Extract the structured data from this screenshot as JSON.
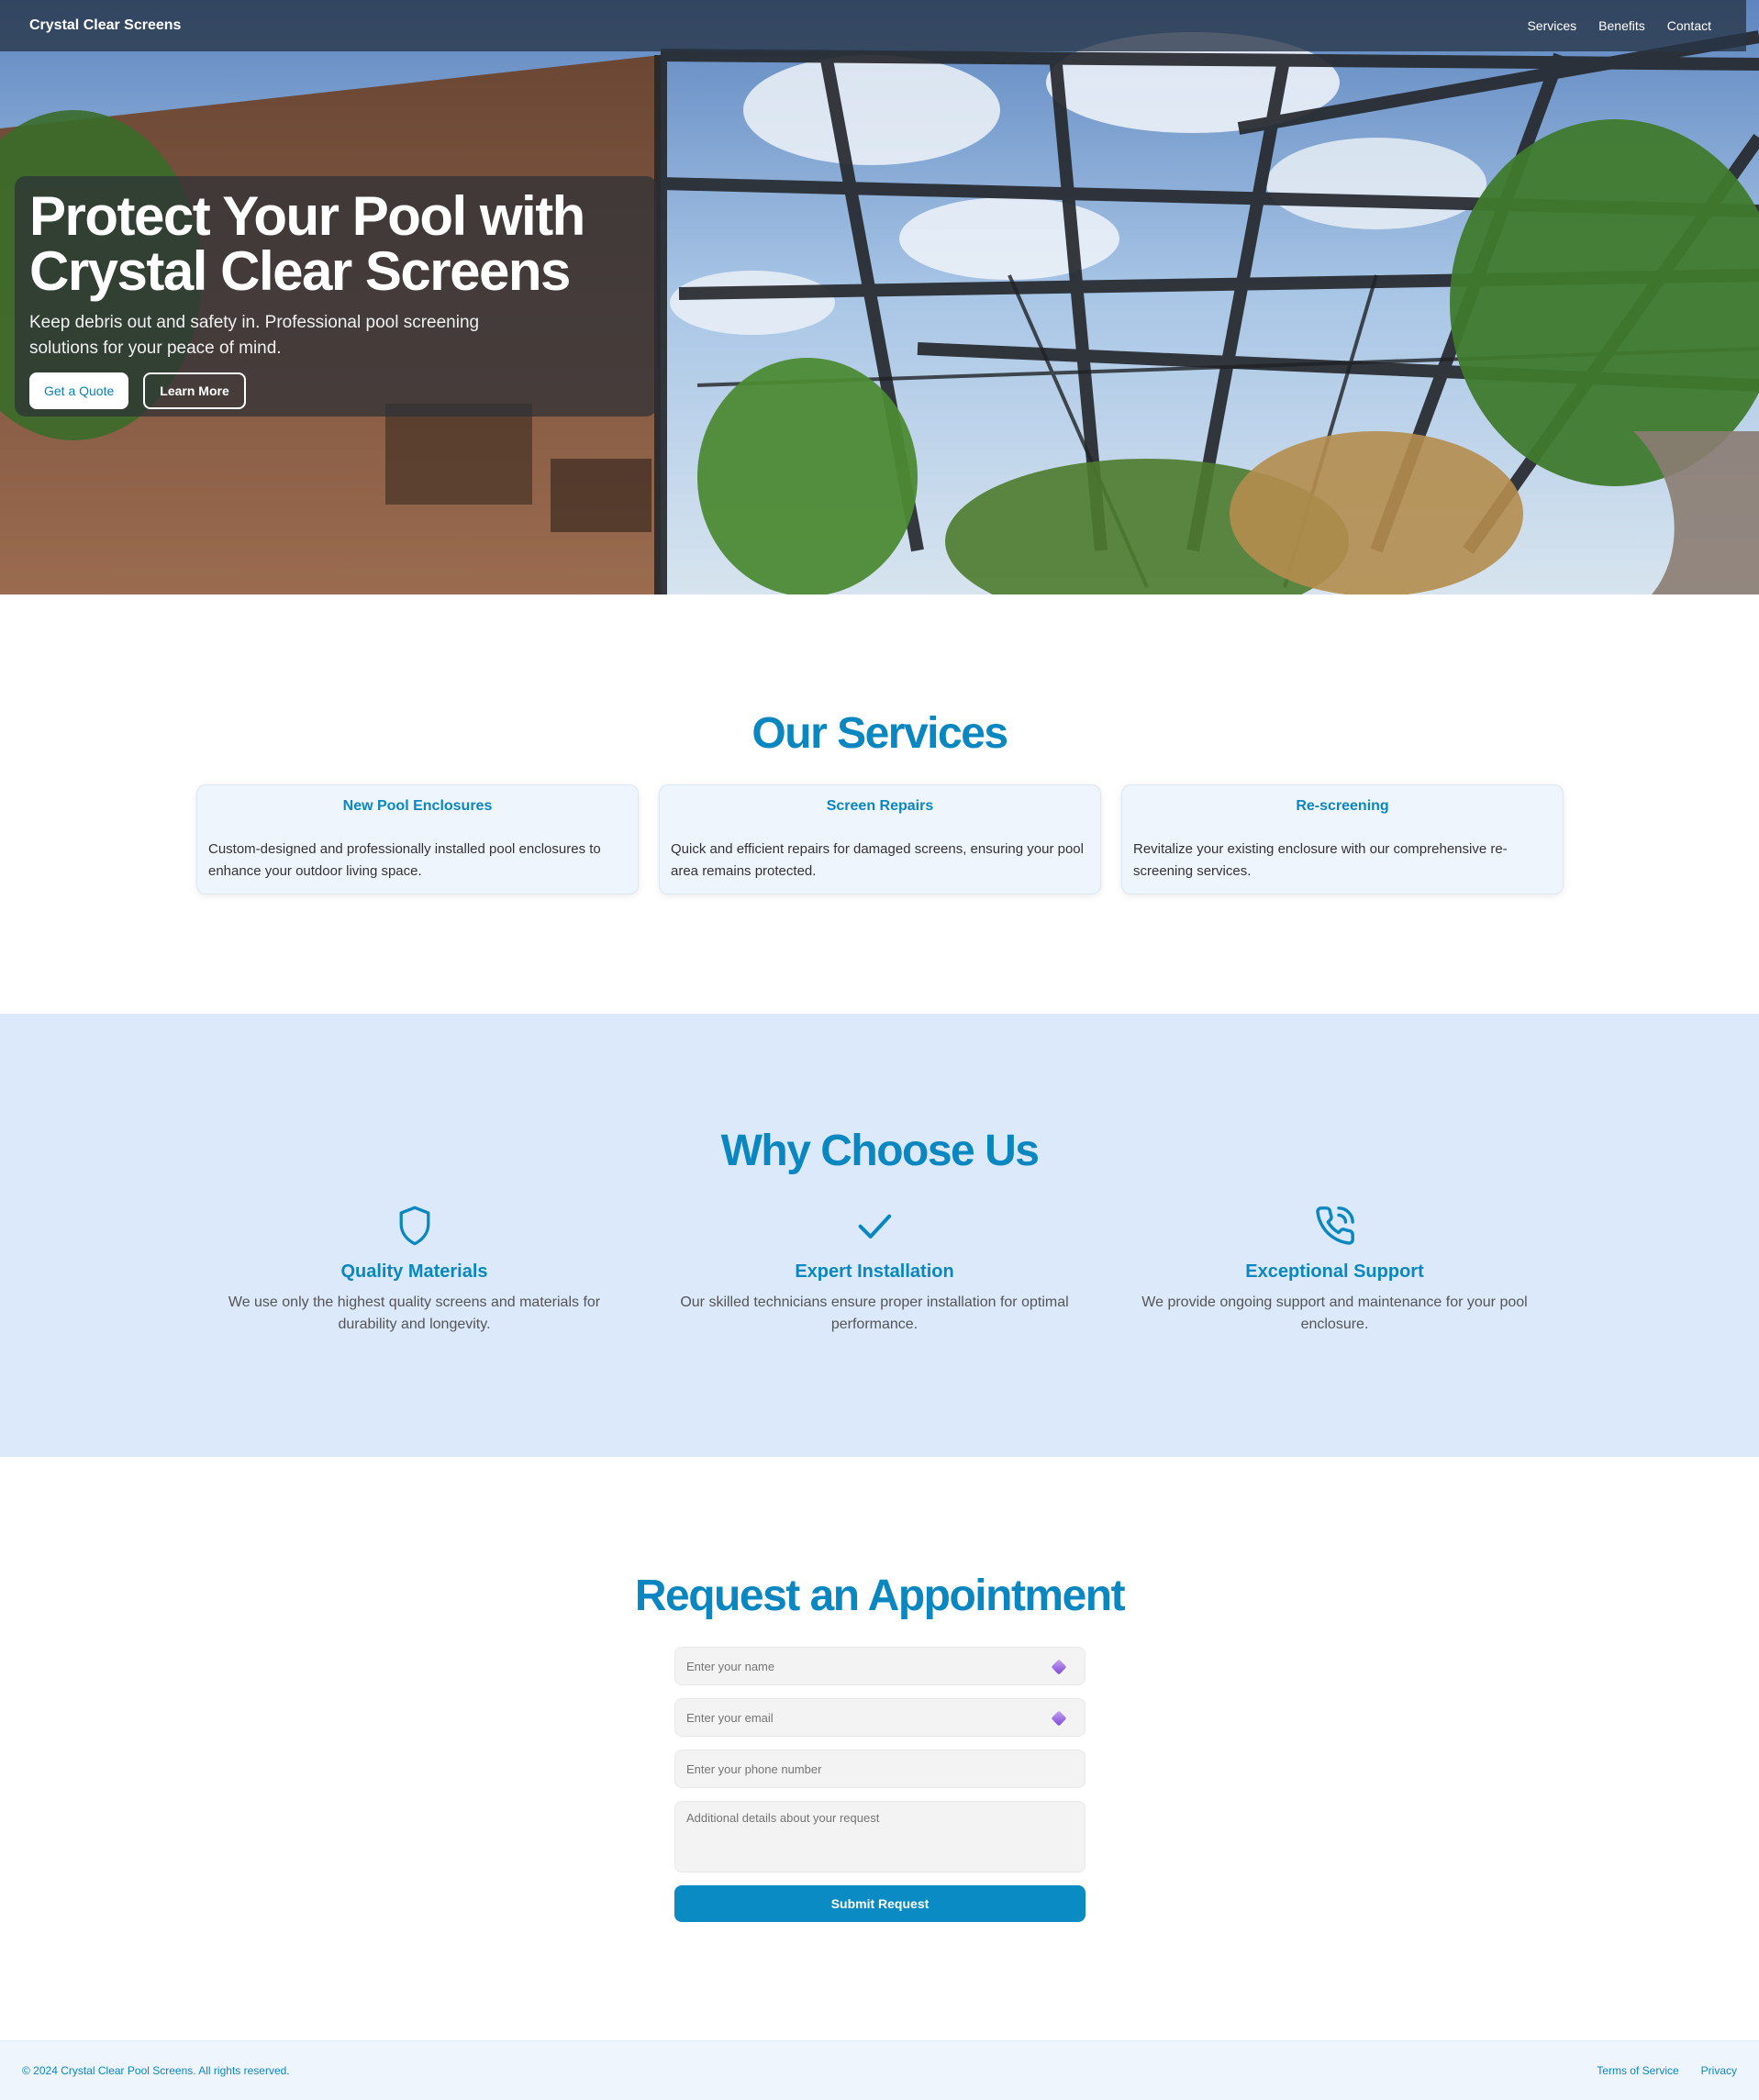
{
  "nav": {
    "brand": "Crystal Clear Screens",
    "links": [
      "Services",
      "Benefits",
      "Contact"
    ]
  },
  "hero": {
    "title_line1": "Protect Your Pool with",
    "title_line2": "Crystal Clear Screens",
    "subtitle": "Keep debris out and safety in. Professional pool screening solutions for your peace of mind.",
    "quote_button": "Get a Quote",
    "learn_button": "Learn More"
  },
  "services": {
    "title": "Our Services",
    "cards": [
      {
        "title": "New Pool Enclosures",
        "text": "Custom-designed and professionally installed pool enclosures to enhance your outdoor living space."
      },
      {
        "title": "Screen Repairs",
        "text": "Quick and efficient repairs for damaged screens, ensuring your pool area remains protected."
      },
      {
        "title": "Re-screening",
        "text": "Revitalize your existing enclosure with our comprehensive re-screening services."
      }
    ]
  },
  "why": {
    "title": "Why Choose Us",
    "features": [
      {
        "icon": "shield-icon",
        "title": "Quality Materials",
        "text": "We use only the highest quality screens and materials for durability and longevity."
      },
      {
        "icon": "check-icon",
        "title": "Expert Installation",
        "text": "Our skilled technicians ensure proper installation for optimal performance."
      },
      {
        "icon": "phone-icon",
        "title": "Exceptional Support",
        "text": "We provide ongoing support and maintenance for your pool enclosure."
      }
    ]
  },
  "appointment": {
    "title": "Request an Appointment",
    "name_placeholder": "Enter your name",
    "email_placeholder": "Enter your email",
    "phone_placeholder": "Enter your phone number",
    "details_placeholder": "Additional details about your request",
    "submit": "Submit Request"
  },
  "footer": {
    "copyright": "© 2024 Crystal Clear Pool Screens. All rights reserved.",
    "terms": "Terms of Service",
    "privacy": "Privacy"
  },
  "colors": {
    "accent": "#0a87c0",
    "button": "#0a8bc4",
    "why_bg": "#dbe9fa",
    "card_bg": "#eef5fd"
  }
}
